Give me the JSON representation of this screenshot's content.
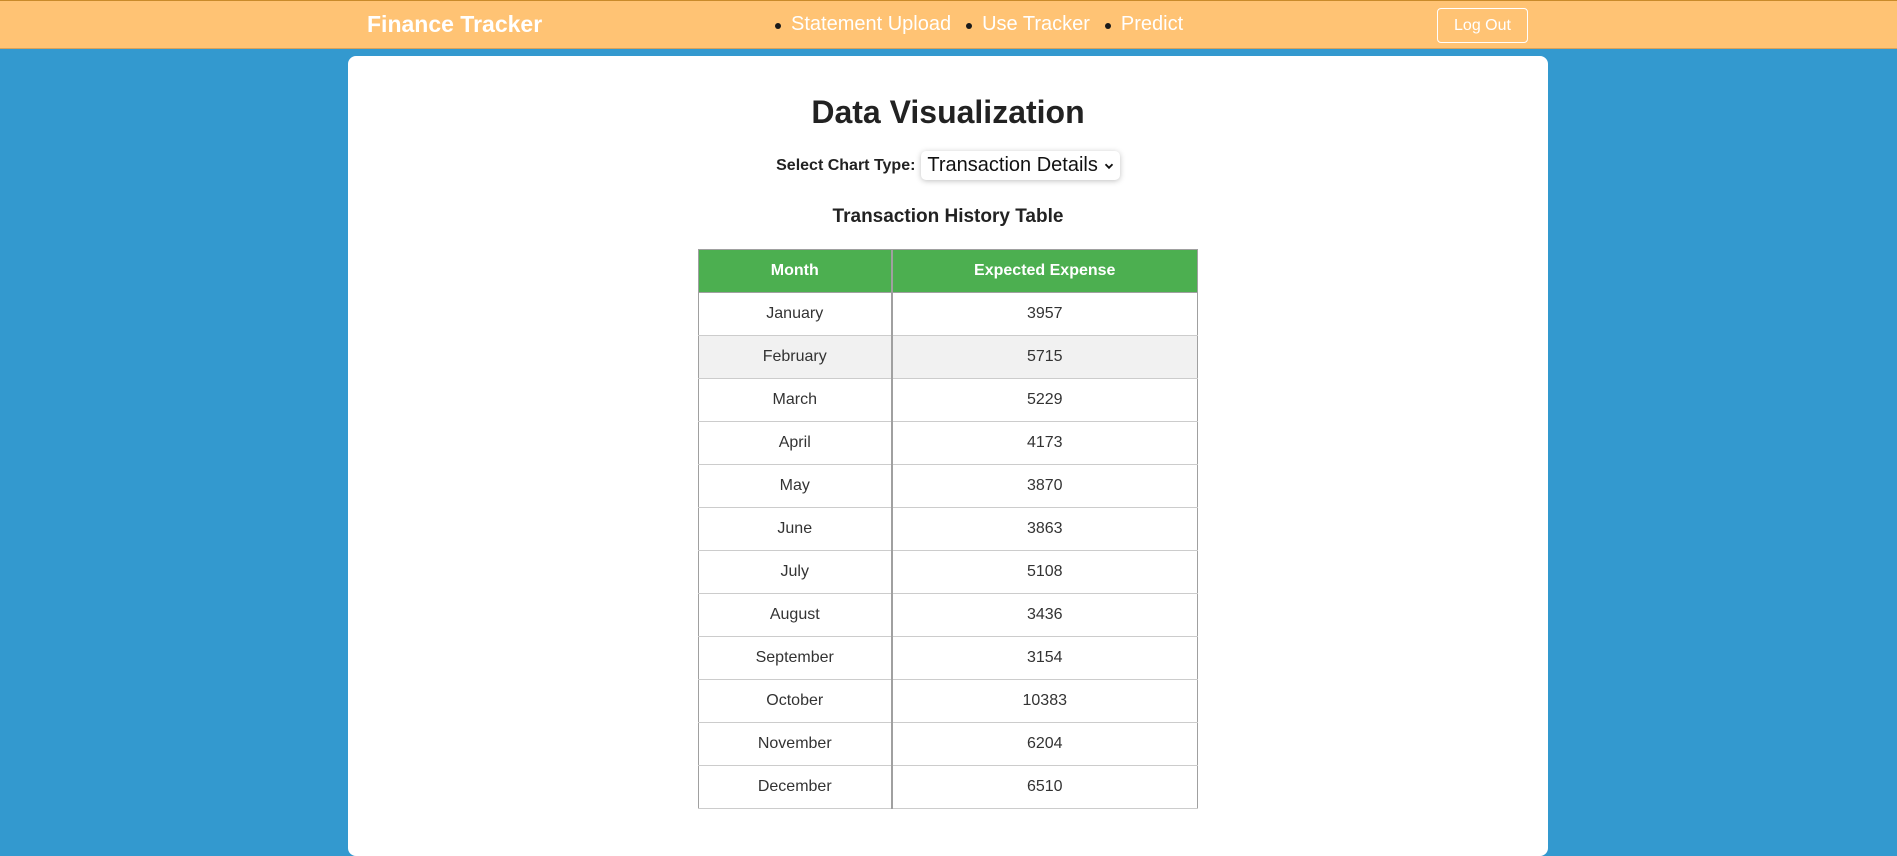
{
  "nav": {
    "brand": "Finance Tracker",
    "links": [
      "Statement Upload",
      "Use Tracker",
      "Predict"
    ],
    "logout_label": "Log Out"
  },
  "main": {
    "title": "Data Visualization",
    "chart_type_label": "Select Chart Type:",
    "chart_type_selected": "Transaction Details",
    "table_title": "Transaction History Table",
    "table": {
      "headers": [
        "Month",
        "Expected Expense"
      ],
      "rows": [
        [
          "January",
          "3957"
        ],
        [
          "February",
          "5715"
        ],
        [
          "March",
          "5229"
        ],
        [
          "April",
          "4173"
        ],
        [
          "May",
          "3870"
        ],
        [
          "June",
          "3863"
        ],
        [
          "July",
          "5108"
        ],
        [
          "August",
          "3436"
        ],
        [
          "September",
          "3154"
        ],
        [
          "October",
          "10383"
        ],
        [
          "November",
          "6204"
        ],
        [
          "December",
          "6510"
        ]
      ]
    }
  },
  "colors": {
    "navbar": "#ffc374",
    "background": "#3399cf",
    "table_header": "#4caf50"
  },
  "icons": {
    "select_arrow": "chevron-down-icon"
  }
}
